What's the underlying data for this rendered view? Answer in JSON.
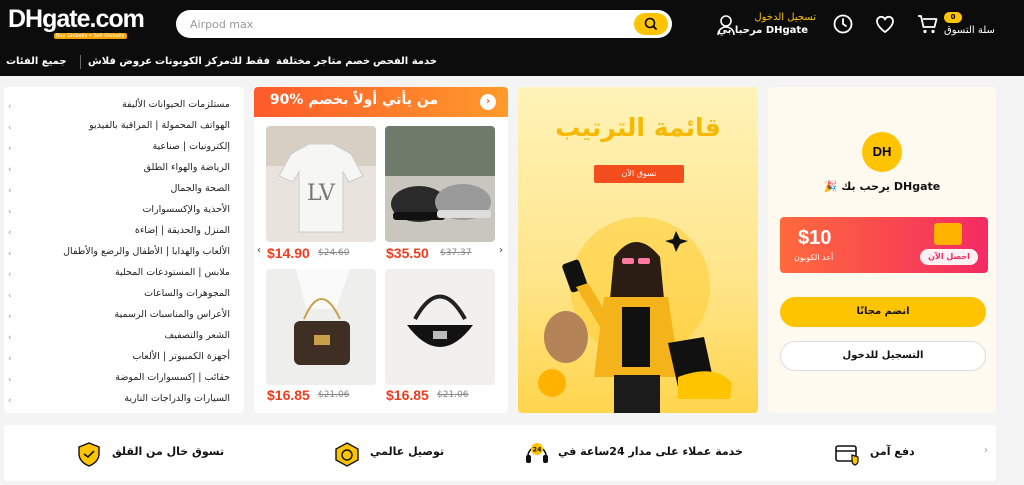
{
  "header": {
    "logo": "DHgate.com",
    "logo_tagline": "Buy Globally • Sell Globally",
    "search_placeholder": "Airpod max",
    "account_line1": "تسجيل الدخول",
    "account_line2": "مرحبا بي DHgate",
    "cart_count": "0",
    "cart_label": "سلة التسوق"
  },
  "nav": {
    "all_categories": "جميع الفئات",
    "items": [
      "عروض فلاش",
      "مركز الكوبونات",
      "فقط لك",
      "خصم متاجر مختلفة",
      "خدمة الفحص"
    ]
  },
  "categories": [
    "مستلزمات الحيوانات الأليفة",
    "الهواتف المحمولة | المراقبة بالفيديو",
    "إلكترونيات | صناعية",
    "الرياضة والهواء الطلق",
    "الصحة والجمال",
    "الأحذية والإكسسوارات",
    "المنزل والحديقة | إضاءة",
    "الألعاب والهدايا | الأطفال والرضع والأطفال",
    "ملابس | المستودعات المحلية",
    "المجوهرات والساعات",
    "الأعراس والمناسبات الرسمية",
    "الشعر والتصفيف",
    "أجهزة الكمبيوتر | الألعاب",
    "حقائب | إكسسوارات الموضة",
    "السيارات والدراجات النارية"
  ],
  "deals": {
    "title": "90% من يأتي أولاً بخصم",
    "products": [
      {
        "price": "$14.90",
        "old": "$24.60"
      },
      {
        "price": "$35.50",
        "old": "$37.37"
      },
      {
        "price": "$16.85",
        "old": "$21.06"
      },
      {
        "price": "$16.85",
        "old": "$21.06"
      }
    ]
  },
  "banner": {
    "title": "قائمة الترتيب",
    "button": "تسوق الآن"
  },
  "welcome": {
    "logo": "DH",
    "greeting": "يرحب بك DHgate",
    "coupon_amount": "$10",
    "coupon_label": "أعد الكوبون",
    "coupon_button": "احصل الآن",
    "join_button": "انضم مجانًا",
    "login_button": "التسجيل للدخول"
  },
  "features": [
    {
      "label": "دفع آمن",
      "icon": "secure-payment-icon"
    },
    {
      "label": "خدمة عملاء على مدار 24ساعة في",
      "icon": "support-24h-icon"
    },
    {
      "label": "توصيل عالمي",
      "icon": "global-delivery-icon"
    },
    {
      "label": "تسوق خال من القلق",
      "icon": "worry-free-shield-icon"
    }
  ],
  "colors": {
    "brand_yellow": "#ffc400",
    "price_red": "#f03c1e",
    "topbar": "#0c0c0c"
  }
}
